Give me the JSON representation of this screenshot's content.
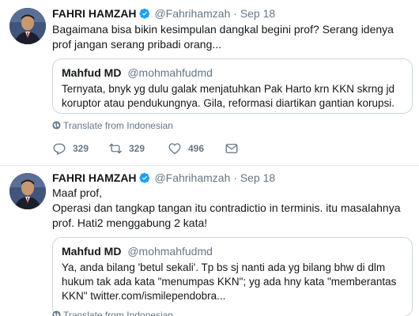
{
  "tweets": [
    {
      "name": "FAHRI HAMZAH",
      "handle": "@Fahrihamzah",
      "separator": "·",
      "time": "Sep 18",
      "text": "Bagaimana bisa bikin kesimpulan dangkal begini prof? Serang idenya prof jangan serang pribadi orang...",
      "quote": {
        "name": "Mahfud MD",
        "handle": "@mohmahfudmd",
        "text": "Ternyata, bnyk yg dulu galak menjatuhkan Pak Harto krn KKN skrng  jd koruptor atau pendukungnya. Gila, reformasi diartikan gantian korupsi."
      },
      "translate": "Translate from Indonesian",
      "replies": "329",
      "retweets": "329",
      "likes": "496"
    },
    {
      "name": "FAHRI HAMZAH",
      "handle": "@Fahrihamzah",
      "separator": "·",
      "time": "Sep 18",
      "text_lines": [
        "Maaf prof,",
        "Operasi dan tangkap tangan itu contradictio in terminis. itu masalahnya prof. Hati2 menggabung 2 kata!"
      ],
      "quote": {
        "name": "Mahfud MD",
        "handle": "@mohmahfudmd",
        "text": "Ya, anda bilang 'betul sekali'. Tp bs sj nanti ada yg bilang bhw di dlm hukum tak ada kata \"menumpas KKN\"; yg ada hny kata \"memberantas KKN\" twitter.com/ismilependobra..."
      },
      "translate": "Translate from Indonesian"
    }
  ],
  "colors": {
    "text": "#14171a",
    "secondary": "#657786",
    "verified": "#1da1f2",
    "border": "#e6ecf0"
  },
  "icons": [
    "verified-badge-icon",
    "globe-icon",
    "reply-icon",
    "retweet-icon",
    "like-icon",
    "direct-message-icon"
  ]
}
